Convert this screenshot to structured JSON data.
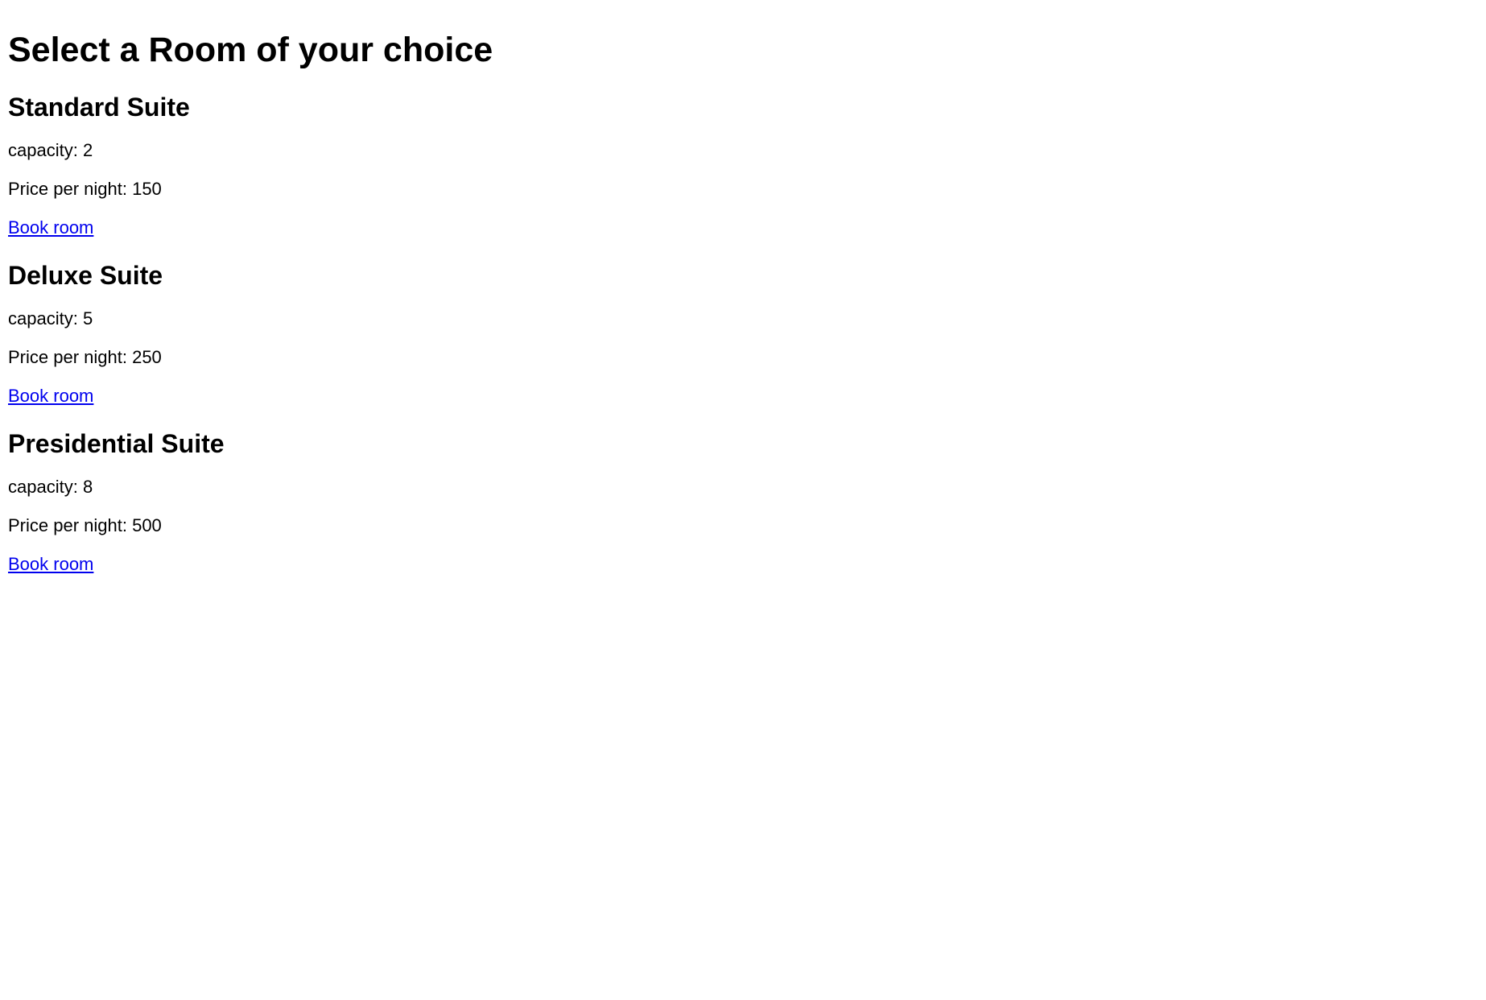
{
  "page": {
    "title": "Select a Room of your choice"
  },
  "labels": {
    "capacity_prefix": "capacity: ",
    "price_prefix": "Price per night: ",
    "book_link": "Book room"
  },
  "rooms": [
    {
      "name": "Standard Suite",
      "capacity": "2",
      "price": "150"
    },
    {
      "name": "Deluxe Suite",
      "capacity": "5",
      "price": "250"
    },
    {
      "name": "Presidential Suite",
      "capacity": "8",
      "price": "500"
    }
  ]
}
